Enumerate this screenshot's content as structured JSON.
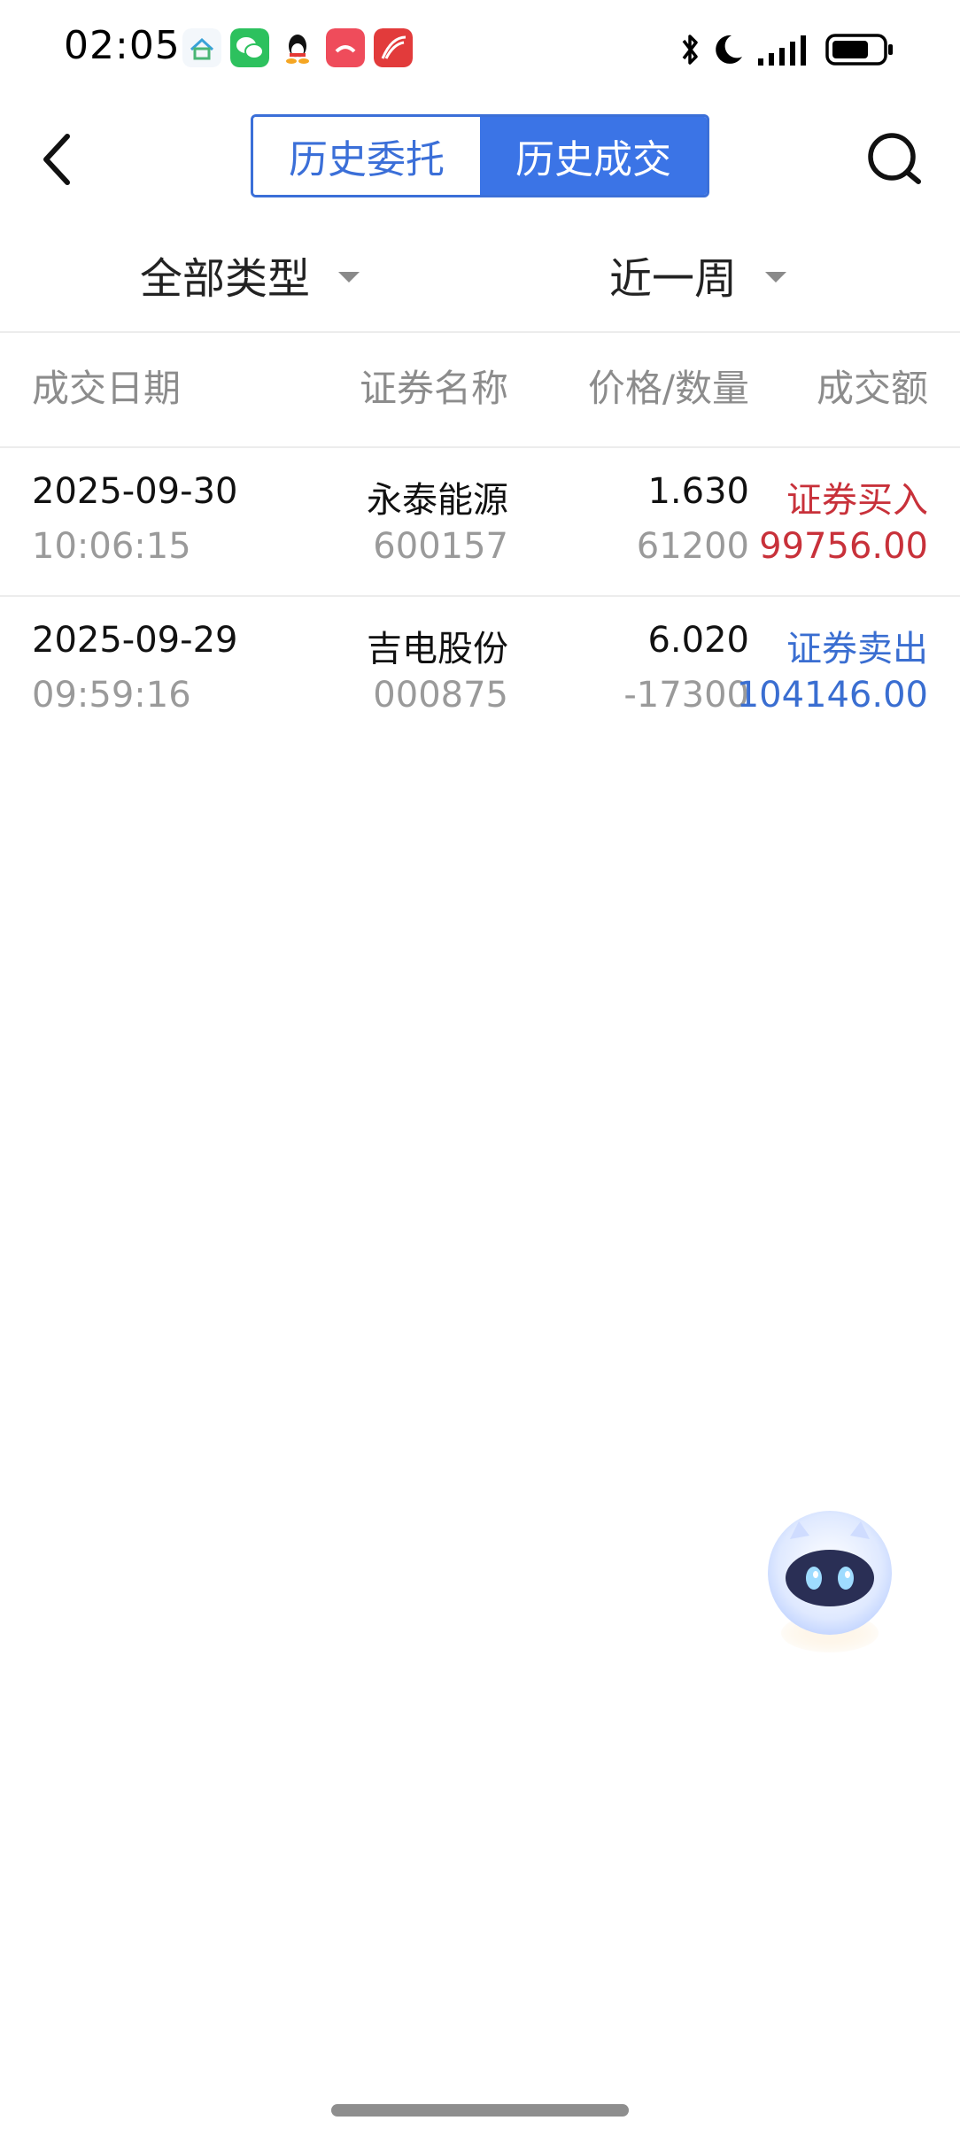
{
  "status_bar": {
    "time": "02:05",
    "app_icons": [
      "home-app-icon",
      "wechat-icon",
      "qq-icon",
      "phone-app-icon",
      "study-app-icon"
    ],
    "system_icons": [
      "bluetooth-icon",
      "moon-icon",
      "signal-icon",
      "battery-icon"
    ]
  },
  "header": {
    "tabs": [
      {
        "label": "历史委托",
        "active": false
      },
      {
        "label": "历史成交",
        "active": true
      }
    ]
  },
  "filters": {
    "type": "全部类型",
    "period": "近一周"
  },
  "table": {
    "headers": [
      "成交日期",
      "证券名称",
      "价格/数量",
      "成交额"
    ],
    "rows": [
      {
        "date": "2025-09-30",
        "time": "10:06:15",
        "name": "永泰能源",
        "code": "600157",
        "price": "1.630",
        "quantity": "61200",
        "direction": "证券买入",
        "amount": "99756.00",
        "color": "#c8313a"
      },
      {
        "date": "2025-09-29",
        "time": "09:59:16",
        "name": "吉电股份",
        "code": "000875",
        "price": "6.020",
        "quantity": "-17300",
        "direction": "证券卖出",
        "amount": "104146.00",
        "color": "#3a6ed1"
      }
    ]
  },
  "colors": {
    "accent": "#3b74e6",
    "buy": "#c8313a",
    "sell": "#3a6ed1"
  }
}
